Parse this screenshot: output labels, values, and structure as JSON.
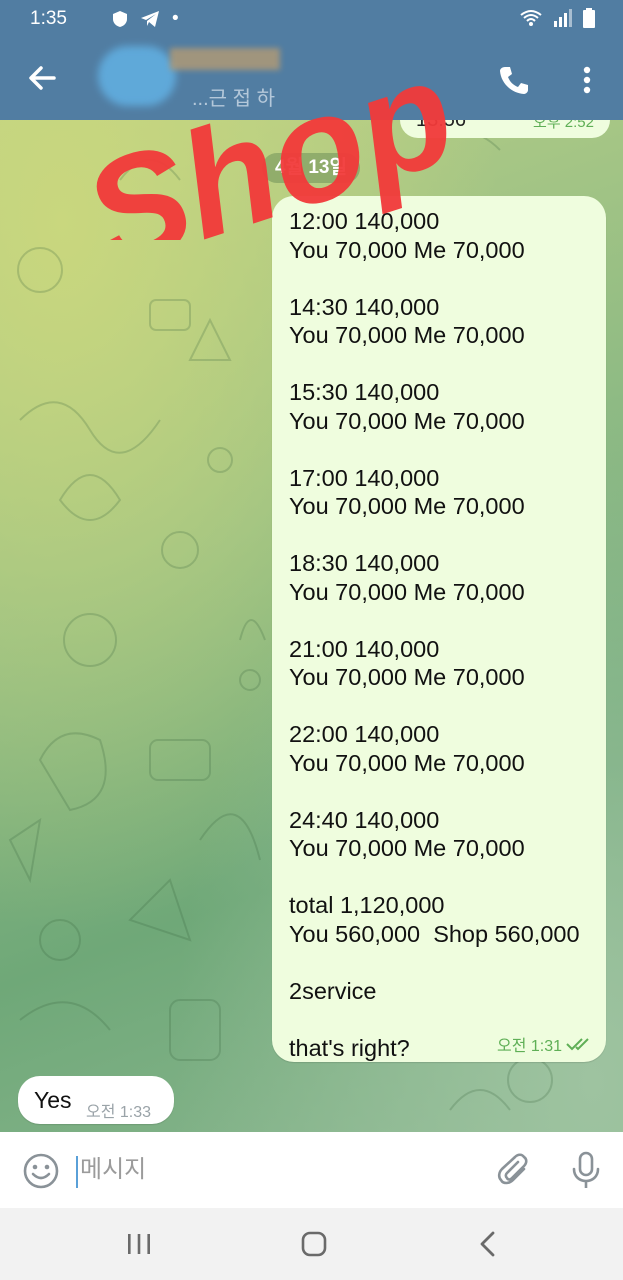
{
  "status_bar": {
    "time": "1:35",
    "notification_dot": "•"
  },
  "header": {
    "title": "...근 접 하"
  },
  "chat": {
    "previous_message": {
      "text": "13:56",
      "time": "오후 2:52"
    },
    "date_divider": "4월 13일",
    "outgoing_message": {
      "text": "12:00 140,000\nYou 70,000 Me 70,000\n\n14:30 140,000\nYou 70,000 Me 70,000\n\n15:30 140,000\nYou 70,000 Me 70,000\n\n17:00 140,000\nYou 70,000 Me 70,000\n\n18:30 140,000\nYou 70,000 Me 70,000\n\n21:00 140,000\nYou 70,000 Me 70,000\n\n22:00 140,000\nYou 70,000 Me 70,000\n\n24:40 140,000\nYou 70,000 Me 70,000\n\ntotal 1,120,000\nYou 560,000  Shop 560,000\n\n2service\n\nthat's right?",
      "time": "오전 1:31"
    },
    "incoming_message": {
      "text": "Yes",
      "time": "오전 1:33"
    }
  },
  "composer": {
    "placeholder": "메시지"
  },
  "watermark": {
    "text": "Shop",
    "color": "#f23a3a"
  },
  "colors": {
    "header": "#517da2",
    "outgoing_bubble": "#effdde",
    "check": "#5faf56"
  },
  "icons": [
    "back-arrow-icon",
    "phone-icon",
    "more-vert-icon",
    "emoji-icon",
    "attach-icon",
    "mic-icon",
    "recent-apps-icon",
    "home-icon",
    "nav-back-icon"
  ]
}
